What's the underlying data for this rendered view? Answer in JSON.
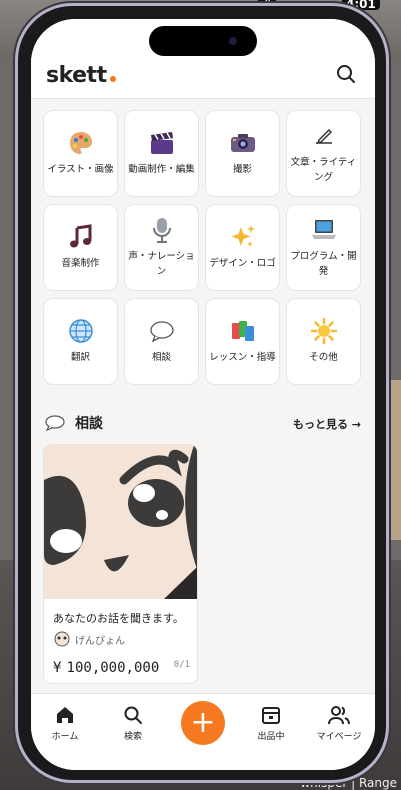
{
  "status": {
    "time": "4:01",
    "signal": "#"
  },
  "watermark": "whisper | Range",
  "header": {
    "logo": "skett",
    "brand_color": "#f07a1a"
  },
  "categories": [
    {
      "label": "イラスト・画像",
      "icon": "palette-icon"
    },
    {
      "label": "動画制作・編集",
      "icon": "clapperboard-icon"
    },
    {
      "label": "撮影",
      "icon": "camera-icon"
    },
    {
      "label": "文章・ライティング",
      "icon": "pen-writing-icon"
    },
    {
      "label": "音楽制作",
      "icon": "music-note-icon"
    },
    {
      "label": "声・ナレーション",
      "icon": "microphone-icon"
    },
    {
      "label": "デザイン・ロゴ",
      "icon": "sparkles-icon"
    },
    {
      "label": "プログラム・開発",
      "icon": "laptop-icon"
    },
    {
      "label": "翻訳",
      "icon": "globe-icon"
    },
    {
      "label": "相談",
      "icon": "speech-bubble-icon"
    },
    {
      "label": "レッスン・指導",
      "icon": "books-icon"
    },
    {
      "label": "その他",
      "icon": "sun-icon"
    }
  ],
  "section": {
    "title": "相談",
    "more": "もっと見る →"
  },
  "listing": {
    "title": "あなたのお話を聞きます。",
    "seller": "げんぴょん",
    "currency": "¥",
    "price": "100,000,000",
    "stock": "0/1"
  },
  "tabs": [
    {
      "label": "ホーム",
      "icon": "home-icon"
    },
    {
      "label": "検索",
      "icon": "search-icon"
    },
    {
      "label": "出品中",
      "icon": "shop-icon"
    },
    {
      "label": "マイページ",
      "icon": "users-icon"
    }
  ],
  "fab": {
    "symbol": "+",
    "color": "#f47920"
  }
}
